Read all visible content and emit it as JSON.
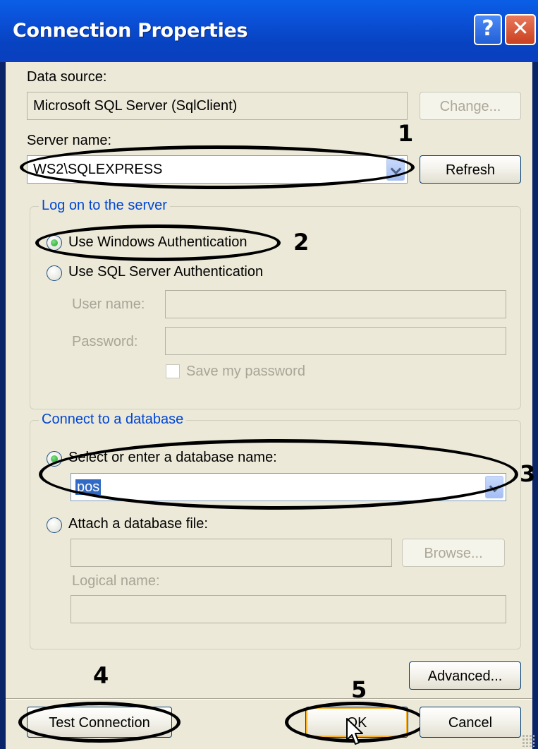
{
  "window": {
    "title": "Connection Properties",
    "help_label": "?",
    "close_label": "✕"
  },
  "data_source": {
    "label": "Data source:",
    "value": "Microsoft SQL Server (SqlClient)",
    "change_button": "Change..."
  },
  "server": {
    "label": "Server name:",
    "value": "WS2\\SQLEXPRESS",
    "refresh_button": "Refresh"
  },
  "logon_group": {
    "title": "Log on to the server",
    "windows_auth": "Use Windows Authentication",
    "sql_auth": "Use SQL Server Authentication",
    "selected": "windows_auth",
    "user_name_label": "User name:",
    "user_name_value": "",
    "password_label": "Password:",
    "password_value": "",
    "save_password_label": "Save my password",
    "save_password_checked": false
  },
  "database_group": {
    "title": "Connect to a database",
    "select_option": "Select or enter a database name:",
    "database_value": "pos",
    "attach_option": "Attach a database file:",
    "selected": "select_option",
    "attach_file_value": "",
    "browse_button": "Browse...",
    "logical_name_label": "Logical name:",
    "logical_name_value": ""
  },
  "buttons": {
    "advanced": "Advanced...",
    "test_connection": "Test Connection",
    "ok": "OK",
    "cancel": "Cancel"
  },
  "annotations": [
    "1",
    "2",
    "3",
    "4",
    "5"
  ],
  "colors": {
    "titlebar": "#0a4fd6",
    "dialog_background": "#ece9d8",
    "group_title": "#0046d5",
    "selection": "#316ac5",
    "annotation": "#000000"
  },
  "icons": {
    "help": "help-icon",
    "close": "close-icon",
    "dropdown": "chevron-down-icon",
    "cursor": "mouse-pointer-icon"
  }
}
